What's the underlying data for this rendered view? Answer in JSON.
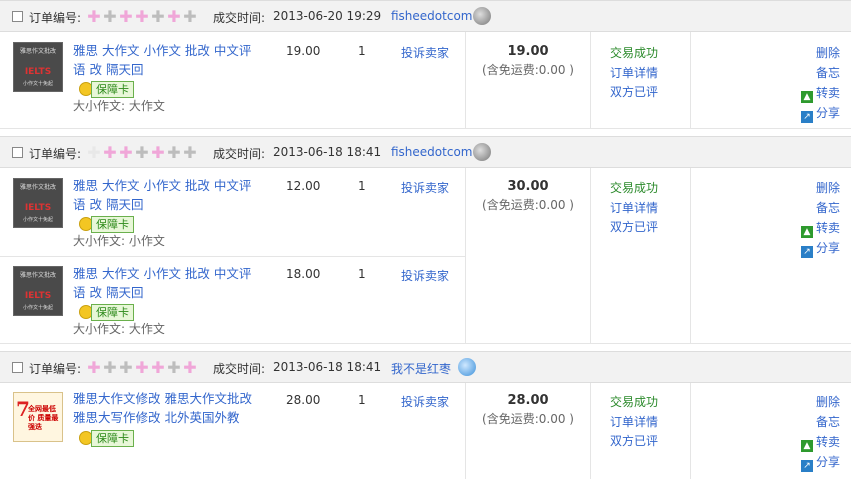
{
  "labels": {
    "order_no": "订单编号:",
    "deal_time": "成交时间:",
    "complain": "投诉卖家",
    "spec": "大小作文: 大作文",
    "spec2": "大小作文: 小作文",
    "badge": "保障卡"
  },
  "orders": [
    {
      "time": "2013-06-20 19:29",
      "seller": "fisheedotcom",
      "items": [
        {
          "title": "雅思 大作文 小作文 批改 中文评语 改 隔天回",
          "spec": "大小作文: 大作文",
          "price": "19.00",
          "qty": "1",
          "thumb": {
            "line1": "雅思作文批改",
            "mark": "IELTS",
            "line3": "小作文十免起"
          }
        }
      ],
      "total": "19.00",
      "shipping": "(含免运费:0.00 )",
      "status": [
        "交易成功",
        "订单详情",
        "双方已评"
      ],
      "actions": [
        "删除",
        "备忘",
        "转卖",
        "分享"
      ]
    },
    {
      "time": "2013-06-18 18:41",
      "seller": "fisheedotcom",
      "items": [
        {
          "title": "雅思 大作文 小作文 批改 中文评语 改 隔天回",
          "spec": "大小作文: 小作文",
          "price": "12.00",
          "qty": "1",
          "thumb": {
            "line1": "雅思作文批改",
            "mark": "IELTS",
            "line3": "小作文十免起"
          }
        },
        {
          "title": "雅思 大作文 小作文 批改 中文评语 改 隔天回",
          "spec": "大小作文: 大作文",
          "price": "18.00",
          "qty": "1",
          "thumb": {
            "line1": "雅思作文批改",
            "mark": "IELTS",
            "line3": "小作文十免起"
          }
        }
      ],
      "total": "30.00",
      "shipping": "(含免运费:0.00 )",
      "status": [
        "交易成功",
        "订单详情",
        "双方已评"
      ],
      "actions": [
        "删除",
        "备忘",
        "转卖",
        "分享"
      ]
    },
    {
      "time": "2013-06-18 18:41",
      "seller": "我不是红枣",
      "items": [
        {
          "title": "雅思大作文修改 雅思大作文批改 雅思大写作修改 北外英国外教",
          "price": "28.00",
          "qty": "1",
          "thumb": {
            "mark": "7",
            "line1": "全网最低价 质量最强迭"
          }
        }
      ],
      "total": "28.00",
      "shipping": "(含免运费:0.00 )",
      "status": [
        "交易成功",
        "订单详情",
        "双方已评"
      ],
      "actions": [
        "删除",
        "备忘",
        "转卖",
        "分享"
      ]
    }
  ],
  "colors": {
    "link": "#3366cc",
    "success": "#2b8a2b",
    "mask_pink": "#f0a6d8",
    "mask_gray": "#bdbdbd"
  }
}
